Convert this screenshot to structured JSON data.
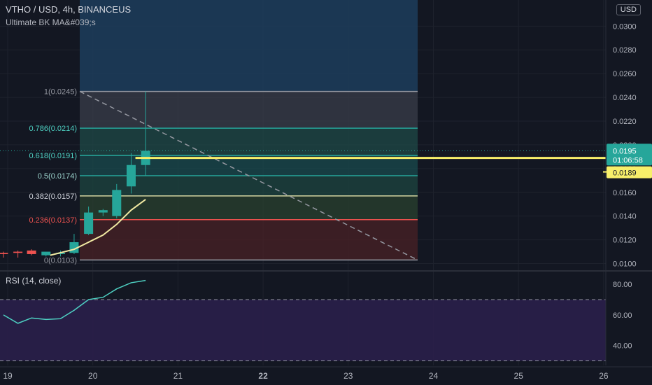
{
  "header": {
    "symbol_line": "VTHO / USD, 4h, BINANCEUS",
    "indicator": "Ultimate BK MA&#039;s",
    "currency_button": "USD"
  },
  "rsi_title": "RSI (14, close)",
  "colors": {
    "background": "#131722",
    "up": "#26a69a",
    "down": "#ef5350",
    "ma": "#f1e9a2",
    "price_line": "#f7ef6a",
    "rsi_line": "#4ed1c3",
    "rsi_band": "#2a1f4a"
  },
  "chart_data": [
    {
      "type": "candlestick",
      "x_ticks": [
        "19",
        "20",
        "21",
        "22",
        "23",
        "24",
        "25",
        "26"
      ],
      "y_ticks": [
        "0.0300",
        "0.0280",
        "0.0260",
        "0.0240",
        "0.0220",
        "0.0200",
        "0.0180",
        "0.0160",
        "0.0140",
        "0.0120",
        "0.0100"
      ],
      "ylim": [
        0.0095,
        0.0322
      ],
      "candles": [
        {
          "t": 18.95,
          "o": 0.0109,
          "h": 0.011,
          "l": 0.0105,
          "c": 0.0108
        },
        {
          "t": 19.12,
          "o": 0.011,
          "h": 0.0111,
          "l": 0.0105,
          "c": 0.0109
        },
        {
          "t": 19.28,
          "o": 0.0111,
          "h": 0.0112,
          "l": 0.0107,
          "c": 0.0108
        },
        {
          "t": 19.45,
          "o": 0.0107,
          "h": 0.0109,
          "l": 0.0106,
          "c": 0.011
        },
        {
          "t": 19.62,
          "o": 0.0108,
          "h": 0.0111,
          "l": 0.0106,
          "c": 0.0109
        },
        {
          "t": 19.78,
          "o": 0.0109,
          "h": 0.0125,
          "l": 0.0108,
          "c": 0.0118
        },
        {
          "t": 19.95,
          "o": 0.0125,
          "h": 0.0148,
          "l": 0.0124,
          "c": 0.0143
        },
        {
          "t": 20.12,
          "o": 0.0143,
          "h": 0.0146,
          "l": 0.014,
          "c": 0.0145
        },
        {
          "t": 20.28,
          "o": 0.014,
          "h": 0.0167,
          "l": 0.0138,
          "c": 0.0162
        },
        {
          "t": 20.45,
          "o": 0.0165,
          "h": 0.0193,
          "l": 0.0159,
          "c": 0.0183
        },
        {
          "t": 20.62,
          "o": 0.0183,
          "h": 0.0245,
          "l": 0.0174,
          "c": 0.0195
        }
      ],
      "ma": [
        {
          "t": 19.5,
          "v": 0.0107
        },
        {
          "t": 19.78,
          "v": 0.0112
        },
        {
          "t": 19.95,
          "v": 0.0118
        },
        {
          "t": 20.12,
          "v": 0.0124
        },
        {
          "t": 20.28,
          "v": 0.0133
        },
        {
          "t": 20.45,
          "v": 0.0145
        },
        {
          "t": 20.62,
          "v": 0.0154
        }
      ],
      "fib_levels": [
        {
          "label": "1(0.0245)",
          "value": 0.0245
        },
        {
          "label": "0.786(0.0214)",
          "value": 0.0214
        },
        {
          "label": "0.618(0.0191)",
          "value": 0.0191
        },
        {
          "label": "0.5(0.0174)",
          "value": 0.0174
        },
        {
          "label": "0.382(0.0157)",
          "value": 0.0157
        },
        {
          "label": "0.236(0.0137)",
          "value": 0.0137
        },
        {
          "label": "0(0.0103)",
          "value": 0.0103
        }
      ],
      "last_price": "0.0195",
      "countdown": "01:06:58",
      "line_price": "0.0189",
      "line_value": 0.0189
    },
    {
      "type": "line",
      "title": "RSI (14, close)",
      "y_ticks": [
        "80.00",
        "60.00",
        "40.00"
      ],
      "ylim": [
        27,
        86
      ],
      "bands": [
        70,
        30
      ],
      "values": [
        {
          "t": 18.95,
          "v": 60
        },
        {
          "t": 19.12,
          "v": 54.5
        },
        {
          "t": 19.28,
          "v": 58
        },
        {
          "t": 19.45,
          "v": 57
        },
        {
          "t": 19.62,
          "v": 57.5
        },
        {
          "t": 19.78,
          "v": 63
        },
        {
          "t": 19.95,
          "v": 70
        },
        {
          "t": 20.12,
          "v": 71.5
        },
        {
          "t": 20.28,
          "v": 77
        },
        {
          "t": 20.45,
          "v": 81
        },
        {
          "t": 20.62,
          "v": 82.5
        }
      ]
    }
  ]
}
